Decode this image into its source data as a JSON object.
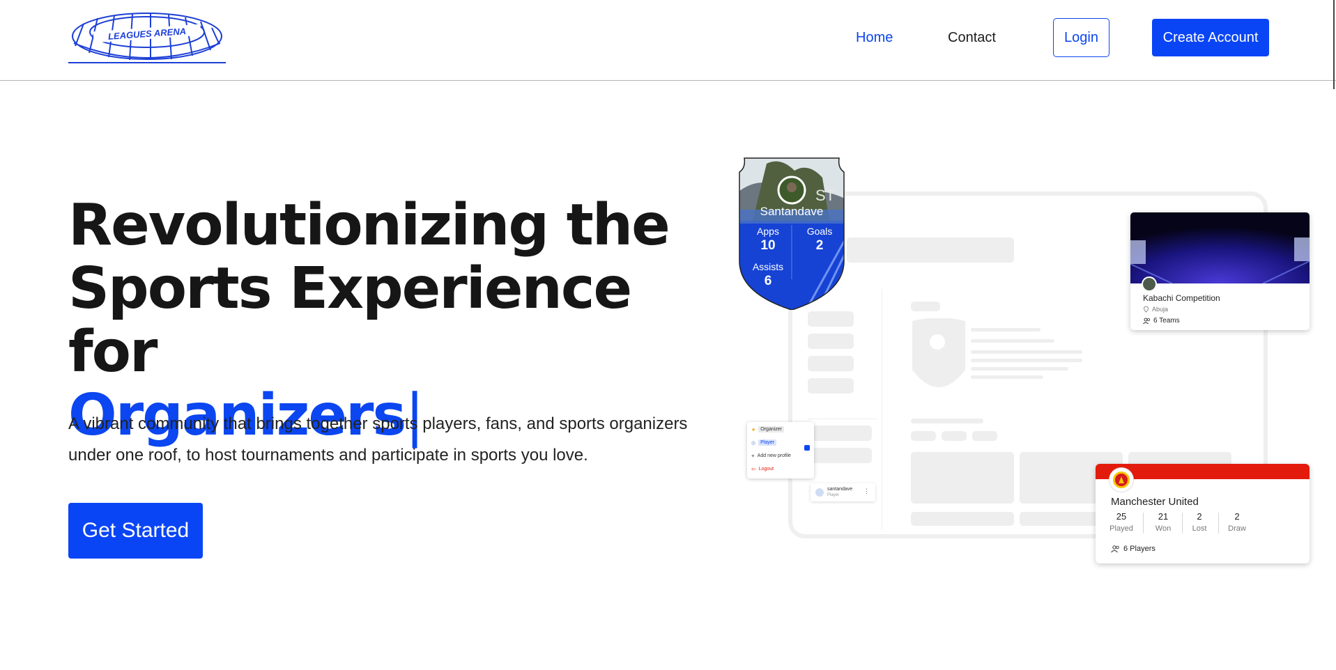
{
  "header": {
    "logo_text": "LEAGUES ARENA",
    "nav": {
      "home": "Home",
      "contact": "Contact"
    },
    "login_label": "Login",
    "create_account_label": "Create Account"
  },
  "hero": {
    "title_line1": "Revolutionizing the",
    "title_line2": "Sports Experience for",
    "title_accent": "Organizers",
    "caret": "|",
    "description": "A vibrant community that brings together sports players, fans, and sports organizers under one roof, to host tournaments and participate in sports you love.",
    "cta_label": "Get Started"
  },
  "player_card": {
    "name": "Santandave",
    "position": "ST",
    "apps_label": "Apps",
    "apps_value": "10",
    "goals_label": "Goals",
    "goals_value": "2",
    "assists_label": "Assists",
    "assists_value": "6"
  },
  "competition_card": {
    "title": "Kabachi Competition",
    "location": "Abuja",
    "teams": "6 Teams"
  },
  "team_card": {
    "name": "Manchester United",
    "stats": [
      {
        "value": "25",
        "label": "Played"
      },
      {
        "value": "21",
        "label": "Won"
      },
      {
        "value": "2",
        "label": "Lost"
      },
      {
        "value": "2",
        "label": "Draw"
      }
    ],
    "players": "6 Players",
    "accent_color": "#e31b0c"
  },
  "profile_menu": {
    "items": [
      "Organizer",
      "Player",
      "Add new profile",
      "Logout"
    ]
  },
  "profile_chip": {
    "name": "santandave",
    "role": "Player"
  },
  "colors": {
    "brand": "#0a45f5",
    "text": "#161616"
  }
}
